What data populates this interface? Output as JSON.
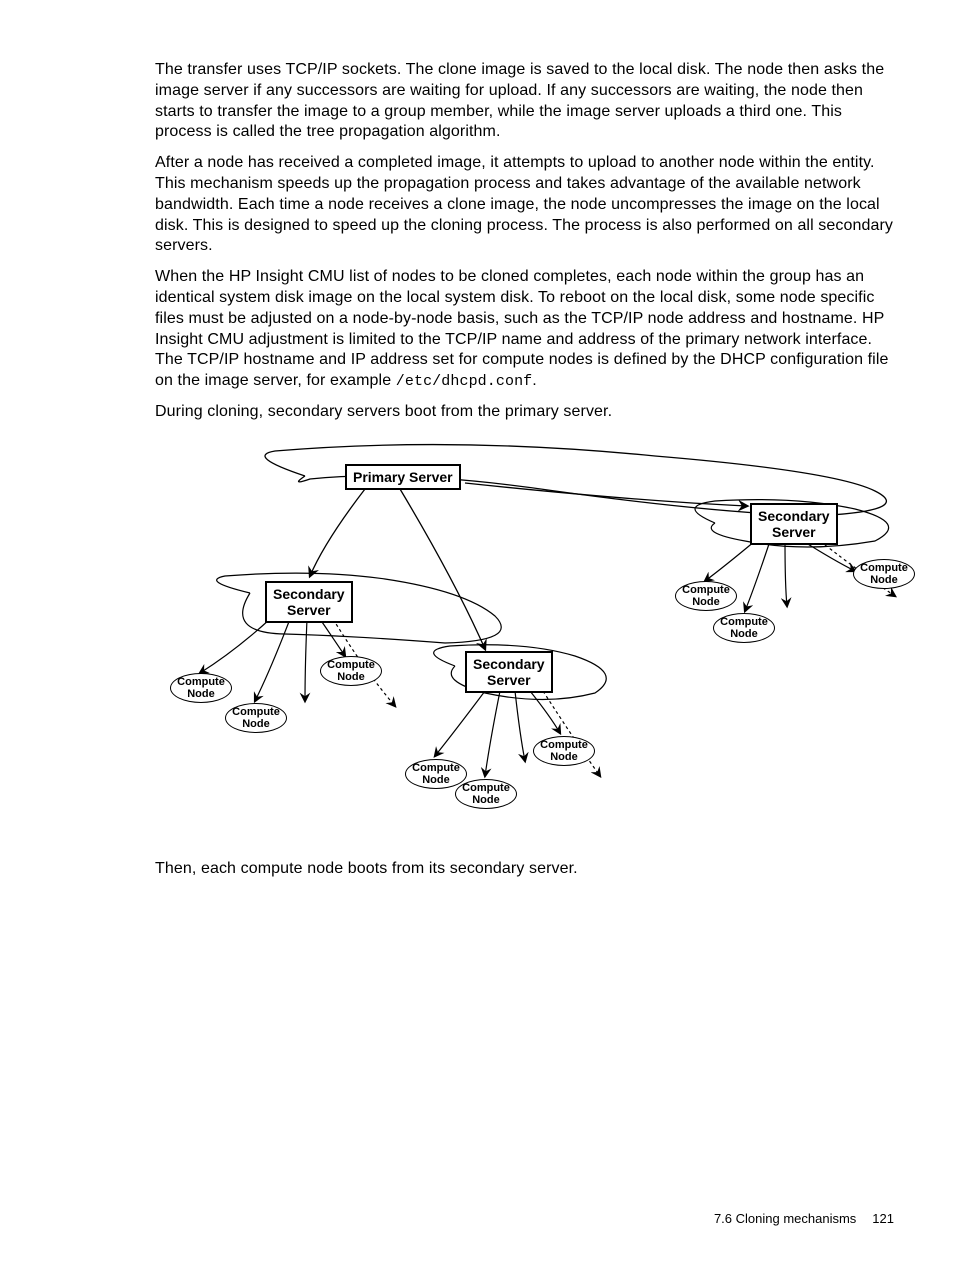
{
  "paragraphs": {
    "p1": "The transfer uses TCP/IP sockets. The clone image is saved to the local disk. The node then asks the image server if any successors are waiting for upload. If any successors are waiting, the node then starts to transfer the image to a group member, while the image server uploads a third one. This process is called the tree propagation algorithm.",
    "p2": "After a node has received a completed image, it attempts to upload to another node within the entity. This mechanism speeds up the propagation process and takes advantage of the available network bandwidth. Each time a node receives a clone image, the node uncompresses the image on the local disk. This is designed to speed up the cloning process. The process is also performed on all secondary servers.",
    "p3_a": "When the HP Insight CMU list of nodes to be cloned completes, each node within the group has an identical system disk image on the local system disk. To reboot on the local disk, some node specific files must be adjusted on a node-by-node basis, such as the TCP/IP node address and hostname. HP Insight CMU adjustment is limited to the TCP/IP name and address of the primary network interface. The TCP/IP hostname and IP address set for compute nodes is defined by the DHCP configuration file on the image server, for example ",
    "p3_code": "/etc/dhcpd.conf",
    "p3_b": ".",
    "p4": "During cloning, secondary servers boot from the primary server.",
    "p5": "Then, each compute node boots from its secondary server."
  },
  "diagram": {
    "primary": "Primary Server",
    "secondary": "Secondary\nServer",
    "compute": "Compute\nNode"
  },
  "footer": {
    "section": "7.6 Cloning mechanisms",
    "page": "121"
  }
}
